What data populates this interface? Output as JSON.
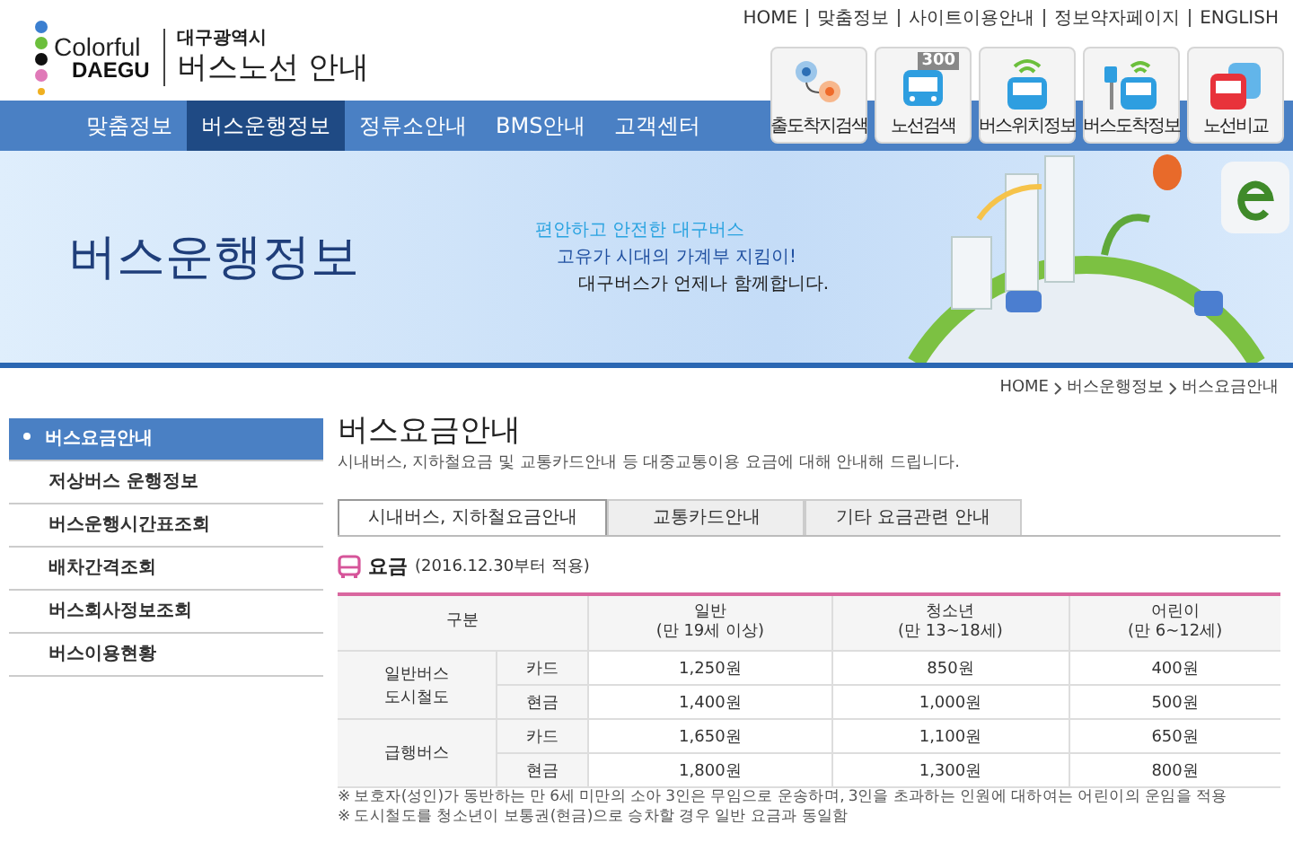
{
  "logo": {
    "word1": "Colorful",
    "word2": "DAEGU"
  },
  "site_title": {
    "city": "대구광역시",
    "name": "버스노선 안내"
  },
  "top_links": [
    "HOME",
    "맞춤정보",
    "사이트이용안내",
    "정보약자페이지",
    "ENGLISH"
  ],
  "nav": [
    {
      "label": "맞춤정보",
      "selected": false
    },
    {
      "label": "버스운행정보",
      "selected": true
    },
    {
      "label": "정류소안내",
      "selected": false
    },
    {
      "label": "BMS안내",
      "selected": false
    },
    {
      "label": "고객센터",
      "selected": false
    }
  ],
  "quick_menu": [
    {
      "kind": "route",
      "label": "출도착지검색"
    },
    {
      "kind": "number",
      "label": "노선검색",
      "badge": "300"
    },
    {
      "kind": "location",
      "label": "버스위치정보"
    },
    {
      "kind": "stop",
      "label": "버스도착정보"
    },
    {
      "kind": "compare",
      "label": "노선비교"
    }
  ],
  "banner": {
    "title": "버스운행정보",
    "slogan": [
      "편안하고 안전한 대구버스",
      "고유가 시대의 가계부 지킴이!",
      "대구버스가 언제나 함께합니다."
    ]
  },
  "breadcrumb": [
    "HOME",
    "버스운행정보",
    "버스요금안내"
  ],
  "sidebar": [
    {
      "label": "버스요금안내",
      "selected": true
    },
    {
      "label": "저상버스 운행정보",
      "selected": false
    },
    {
      "label": "버스운행시간표조회",
      "selected": false
    },
    {
      "label": "배차간격조회",
      "selected": false
    },
    {
      "label": "버스회사정보조회",
      "selected": false
    },
    {
      "label": "버스이용현황",
      "selected": false
    }
  ],
  "page": {
    "title": "버스요금안내",
    "description": "시내버스, 지하철요금 및 교통카드안내 등 대중교통이용 요금에 대해 안내해 드립니다."
  },
  "tabs": [
    {
      "label": "시내버스, 지하철요금안내",
      "selected": true
    },
    {
      "label": "교통카드안내",
      "selected": false
    },
    {
      "label": "기타 요금관련 안내",
      "selected": false
    }
  ],
  "section": {
    "title": "요금",
    "note": "(2016.12.30부터 적용)"
  },
  "fare_table": {
    "header_group": "구분",
    "columns": [
      {
        "name": "일반",
        "age": "(만 19세 이상)"
      },
      {
        "name": "청소년",
        "age": "(만 13~18세)"
      },
      {
        "name": "어린이",
        "age": "(만 6~12세)"
      }
    ],
    "groups": [
      {
        "name": [
          "일반버스",
          "도시철도"
        ],
        "rows": [
          {
            "payment": "카드",
            "fares": [
              "1,250원",
              "850원",
              "400원"
            ]
          },
          {
            "payment": "현금",
            "fares": [
              "1,400원",
              "1,000원",
              "500원"
            ]
          }
        ]
      },
      {
        "name": [
          "급행버스"
        ],
        "rows": [
          {
            "payment": "카드",
            "fares": [
              "1,650원",
              "1,100원",
              "650원"
            ]
          },
          {
            "payment": "현금",
            "fares": [
              "1,800원",
              "1,300원",
              "800원"
            ]
          }
        ]
      }
    ]
  },
  "notes": [
    "※ 보호자(성인)가 동반하는 만 6세 미만의 소아 3인은 무임으로 운송하며, 3인을 초과하는 인원에 대하여는 어린이의 운임을 적용",
    "※ 도시철도를 청소년이 보통권(현금)으로 승차할 경우 일반 요금과 동일함"
  ]
}
